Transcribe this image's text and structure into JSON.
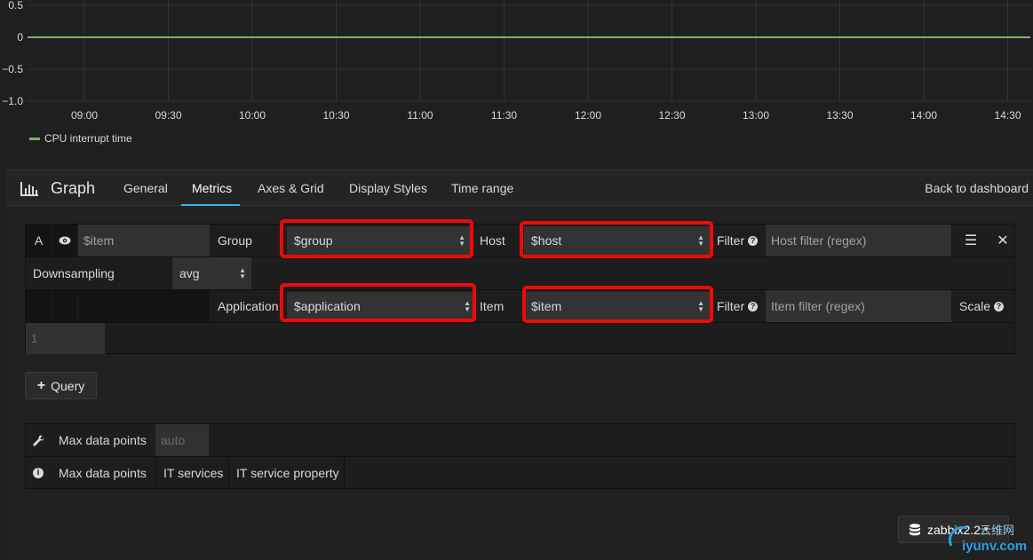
{
  "chart_data": {
    "type": "line",
    "y_ticks": [
      "0.5",
      "0",
      "−0.5",
      "−1.0"
    ],
    "x_ticks": [
      "09:00",
      "09:30",
      "10:00",
      "10:30",
      "11:00",
      "11:30",
      "12:00",
      "12:30",
      "13:00",
      "13:30",
      "14:00",
      "14:30"
    ],
    "ylim": [
      -1.0,
      0.5
    ],
    "grid": true,
    "legend_placement": "bottom-left",
    "series": [
      {
        "name": "CPU interrupt time",
        "color": "#7eb26d",
        "values": [
          0,
          0,
          0,
          0,
          0,
          0,
          0,
          0,
          0,
          0,
          0,
          0
        ]
      }
    ]
  },
  "editor": {
    "title": "Graph",
    "tabs": [
      "General",
      "Metrics",
      "Axes & Grid",
      "Display Styles",
      "Time range"
    ],
    "active_tab": "Metrics",
    "back_link": "Back to dashboard"
  },
  "query": {
    "ref_id": "A",
    "alias": "$item",
    "group_label": "Group",
    "group_value": "$group",
    "host_label": "Host",
    "host_value": "$host",
    "filter_label": "Filter",
    "host_filter_placeholder": "Host filter (regex)",
    "downsampling_label": "Downsampling",
    "downsampling_value": "avg",
    "application_label": "Application",
    "application_value": "$application",
    "item_label": "Item",
    "item_value": "$item",
    "item_filter_placeholder": "Item filter (regex)",
    "scale_label": "Scale",
    "scale_placeholder": "1"
  },
  "add_query_label": "Query",
  "options": {
    "row1_label": "Max data points",
    "row1_placeholder": "auto",
    "row2_label": "Max data points",
    "row2_btn1": "IT services",
    "row2_btn2": "IT service property"
  },
  "datasource": {
    "label": "zabbix2.2"
  },
  "watermark": {
    "line1": "云维网",
    "line2": "iyunv.com"
  },
  "accent_color": "#33b5e5",
  "highlight_color": "#ee0a0a"
}
